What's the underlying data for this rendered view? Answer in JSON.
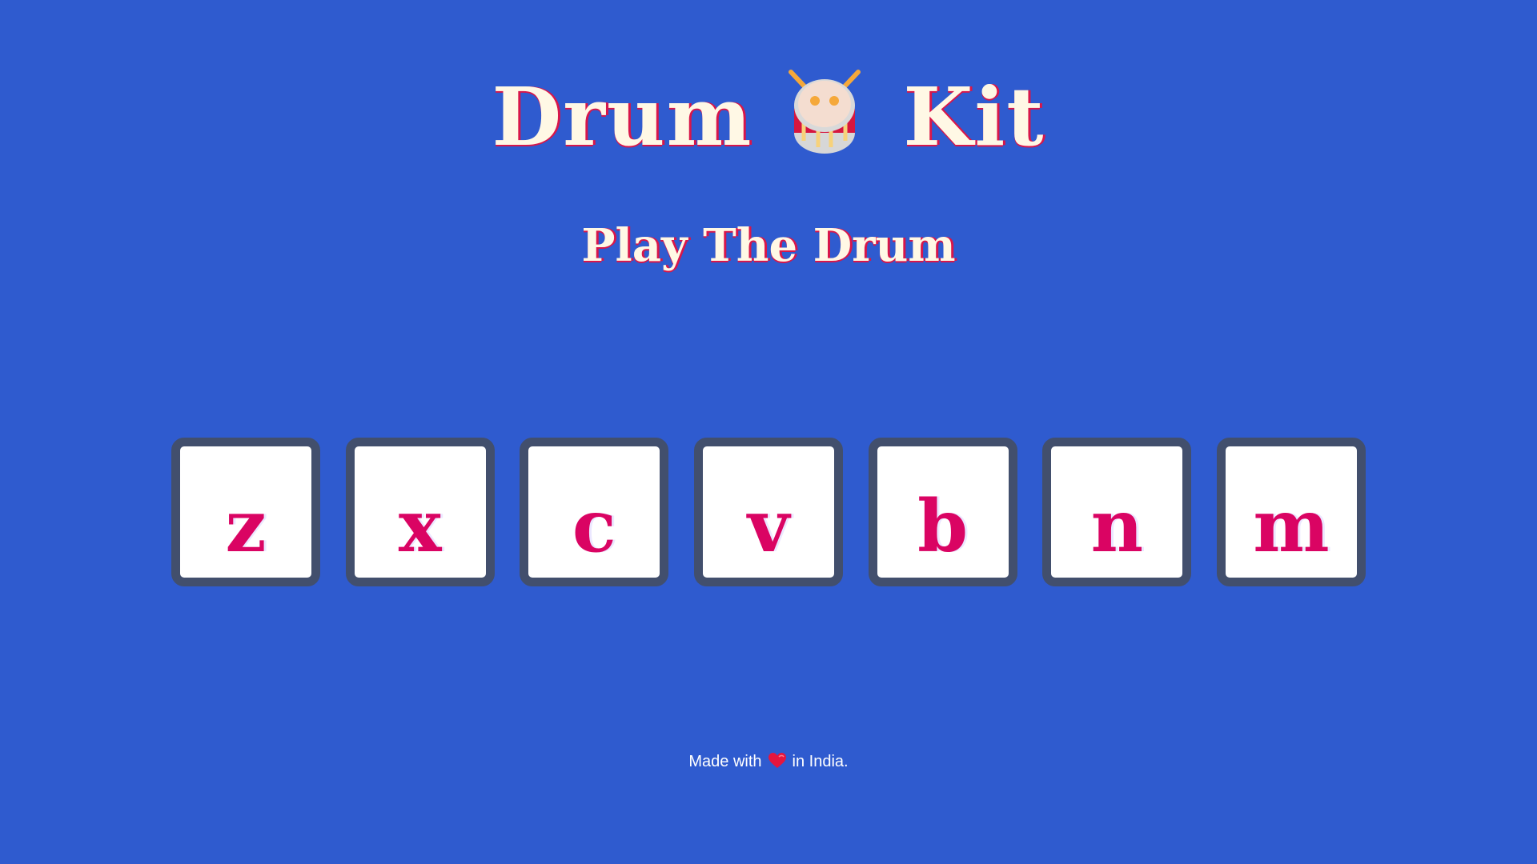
{
  "header": {
    "title_part1": "Drum",
    "title_icon": "drum-icon",
    "title_part2": "Kit",
    "subtitle": "Play The Drum"
  },
  "pads": [
    {
      "key": "z"
    },
    {
      "key": "x"
    },
    {
      "key": "c"
    },
    {
      "key": "v"
    },
    {
      "key": "b"
    },
    {
      "key": "n"
    },
    {
      "key": "m"
    }
  ],
  "footer": {
    "text_before": "Made with",
    "icon": "heart-icon",
    "text_after": "in India."
  },
  "colors": {
    "background": "#2f5bcf",
    "title_text": "#fff8e5",
    "title_shadow": "#d8164a",
    "pad_border": "#424f6d",
    "pad_letter": "#da0463"
  }
}
